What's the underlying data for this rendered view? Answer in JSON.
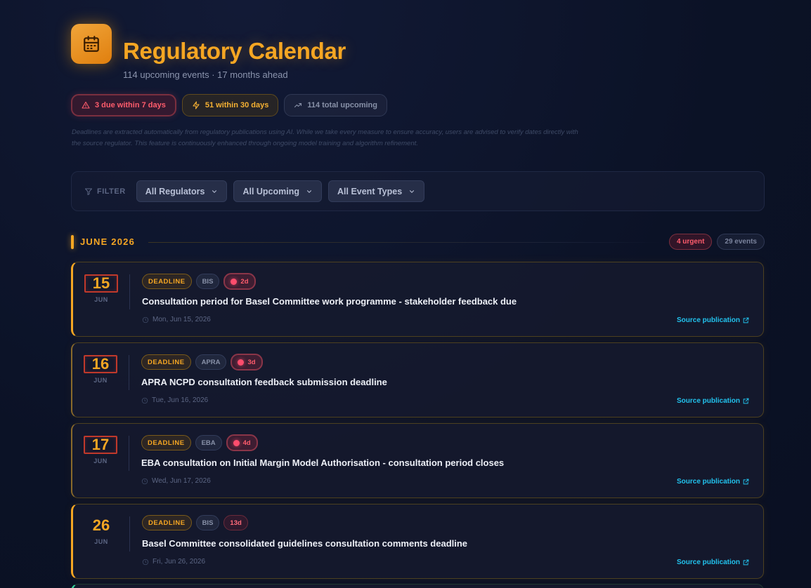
{
  "header": {
    "title": "Regulatory Calendar",
    "subtitle": "114 upcoming events · 17 months ahead"
  },
  "stats": {
    "urgent": "3 due within 7 days",
    "soon": "51 within 30 days",
    "total": "114 total upcoming"
  },
  "disclaimer": "Deadlines are extracted automatically from regulatory publications using AI. While we take every measure to ensure accuracy, users are advised to verify dates directly with the source regulator. This feature is continuously enhanced through ongoing model training and algorithm refinement.",
  "filters": {
    "label": "FILTER",
    "regulators": "All Regulators",
    "timeframe": "All Upcoming",
    "event_types": "All Event Types"
  },
  "month": {
    "title": "JUNE 2026",
    "urgent_badge": "4 urgent",
    "count_badge": "29 events"
  },
  "events": [
    {
      "day": "15",
      "mon": "JUN",
      "type": "DEADLINE",
      "regulator": "BIS",
      "countdown": "2d",
      "title": "Consultation period for Basel Committee work programme - stakeholder feedback due",
      "date": "Mon, Jun 15, 2026",
      "source": "Source publication"
    },
    {
      "day": "16",
      "mon": "JUN",
      "type": "DEADLINE",
      "regulator": "APRA",
      "countdown": "3d",
      "title": "APRA NCPD consultation feedback submission deadline",
      "date": "Tue, Jun 16, 2026",
      "source": "Source publication"
    },
    {
      "day": "17",
      "mon": "JUN",
      "type": "DEADLINE",
      "regulator": "EBA",
      "countdown": "4d",
      "title": "EBA consultation on Initial Margin Model Authorisation - consultation period closes",
      "date": "Wed, Jun 17, 2026",
      "source": "Source publication"
    },
    {
      "day": "26",
      "mon": "JUN",
      "type": "DEADLINE",
      "regulator": "BIS",
      "countdown": "13d",
      "title": "Basel Committee consolidated guidelines consultation comments deadline",
      "date": "Fri, Jun 26, 2026",
      "source": "Source publication"
    }
  ],
  "colors": {
    "accent": "#f5a623",
    "urgent": "#ff5c6c",
    "link": "#22c3ee",
    "background": "#0b1226"
  }
}
